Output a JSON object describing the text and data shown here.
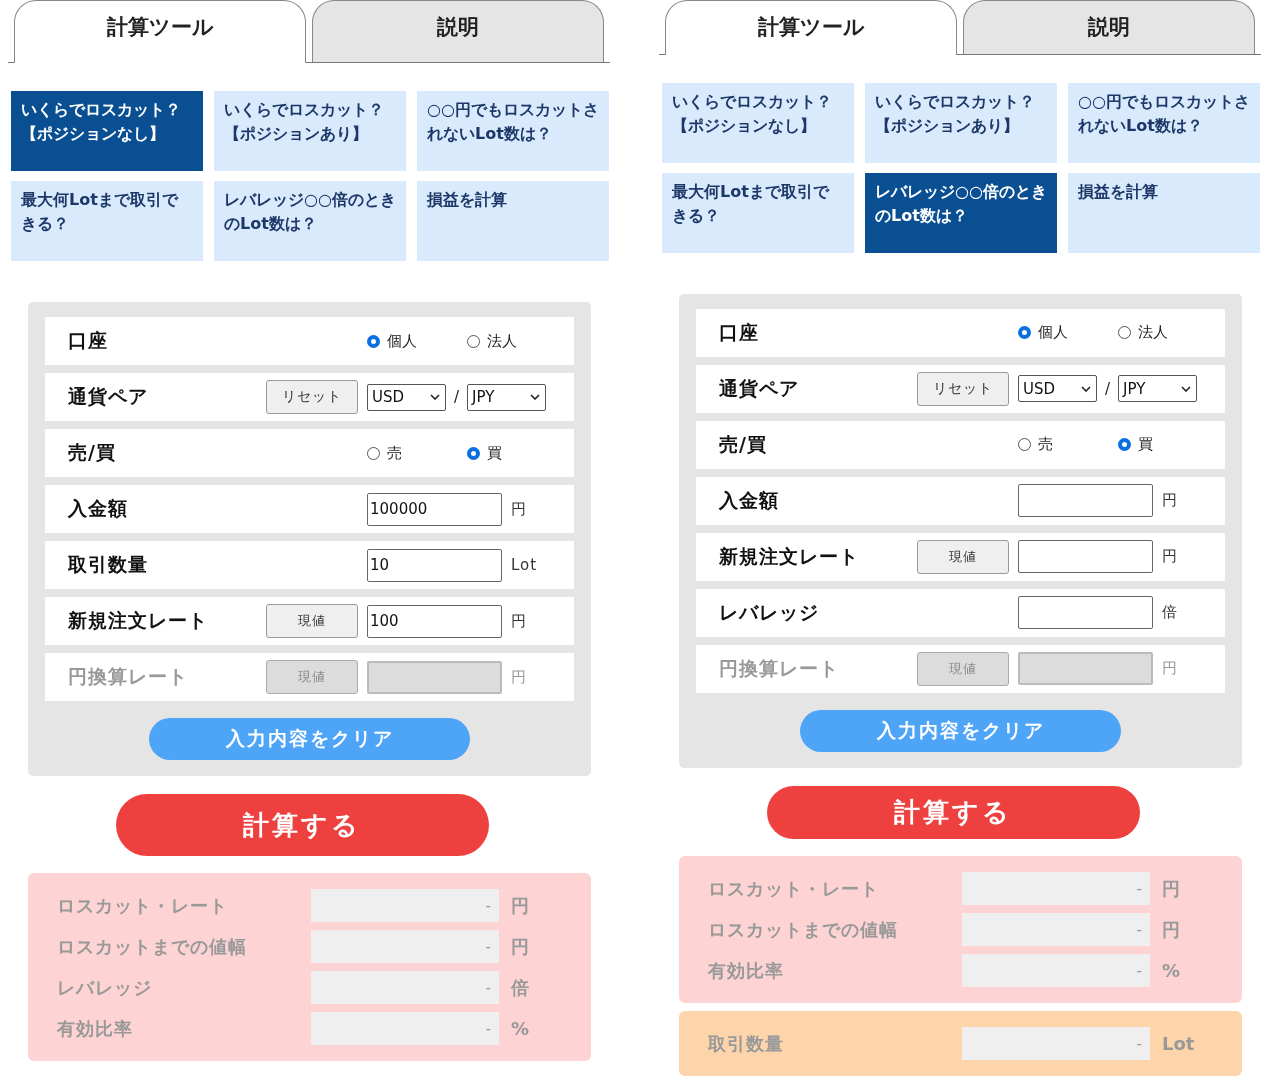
{
  "panels": [
    {
      "tabs": [
        {
          "label": "計算ツール",
          "selected": true
        },
        {
          "label": "説明",
          "selected": false
        }
      ],
      "tools": [
        {
          "label": "いくらでロスカット？【ポジションなし】",
          "selected": true
        },
        {
          "label": "いくらでロスカット？【ポジションあり】",
          "selected": false
        },
        {
          "label": "○○円でもロスカットされないLot数は？",
          "selected": false
        },
        {
          "label": "最大何Lotまで取引できる？",
          "selected": false
        },
        {
          "label": "レバレッジ○○倍のときのLot数は？",
          "selected": false
        },
        {
          "label": "損益を計算",
          "selected": false
        }
      ],
      "form": {
        "rows": [
          {
            "kind": "radio",
            "label": "口座",
            "options": [
              {
                "label": "個人",
                "selected": true
              },
              {
                "label": "法人",
                "selected": false
              }
            ]
          },
          {
            "kind": "currency",
            "label": "通貨ペア",
            "button": "リセット",
            "base": "USD",
            "separator": "/",
            "quote": "JPY"
          },
          {
            "kind": "radio",
            "label": "売/買",
            "options": [
              {
                "label": "売",
                "selected": false
              },
              {
                "label": "買",
                "selected": true
              }
            ]
          },
          {
            "kind": "input",
            "label": "入金額",
            "value": "100000",
            "unit": "円",
            "disabled": false
          },
          {
            "kind": "input",
            "label": "取引数量",
            "value": "10",
            "unit": "Lot",
            "disabled": false
          },
          {
            "kind": "input",
            "label": "新規注文レート",
            "button": "現値",
            "value": "100",
            "unit": "円",
            "disabled": false
          },
          {
            "kind": "input",
            "label": "円換算レート",
            "button": "現値",
            "unit": "円",
            "disabled": true
          }
        ],
        "clear_button": "入力内容をクリア"
      },
      "calculate_button": "計算する",
      "results": [
        {
          "color": "#fdd3d4",
          "rows": [
            {
              "label": "ロスカット・レート",
              "value": "-",
              "unit": "円"
            },
            {
              "label": "ロスカットまでの値幅",
              "value": "-",
              "unit": "円"
            },
            {
              "label": "レバレッジ",
              "value": "-",
              "unit": "倍"
            },
            {
              "label": "有効比率",
              "value": "-",
              "unit": "%"
            }
          ]
        }
      ]
    },
    {
      "tabs": [
        {
          "label": "計算ツール",
          "selected": true
        },
        {
          "label": "説明",
          "selected": false
        }
      ],
      "tools": [
        {
          "label": "いくらでロスカット？【ポジションなし】",
          "selected": false
        },
        {
          "label": "いくらでロスカット？【ポジションあり】",
          "selected": false
        },
        {
          "label": "○○円でもロスカットされないLot数は？",
          "selected": false
        },
        {
          "label": "最大何Lotまで取引できる？",
          "selected": false
        },
        {
          "label": "レバレッジ○○倍のときのLot数は？",
          "selected": true
        },
        {
          "label": "損益を計算",
          "selected": false
        }
      ],
      "form": {
        "rows": [
          {
            "kind": "radio",
            "label": "口座",
            "options": [
              {
                "label": "個人",
                "selected": true
              },
              {
                "label": "法人",
                "selected": false
              }
            ]
          },
          {
            "kind": "currency",
            "label": "通貨ペア",
            "button": "リセット",
            "base": "USD",
            "separator": "/",
            "quote": "JPY"
          },
          {
            "kind": "radio",
            "label": "売/買",
            "options": [
              {
                "label": "売",
                "selected": false
              },
              {
                "label": "買",
                "selected": true
              }
            ]
          },
          {
            "kind": "input",
            "label": "入金額",
            "unit": "円",
            "disabled": false
          },
          {
            "kind": "input",
            "label": "新規注文レート",
            "button": "現値",
            "unit": "円",
            "disabled": false
          },
          {
            "kind": "input",
            "label": "レバレッジ",
            "unit": "倍",
            "disabled": false
          },
          {
            "kind": "input",
            "label": "円換算レート",
            "button": "現値",
            "unit": "円",
            "disabled": true
          }
        ],
        "clear_button": "入力内容をクリア"
      },
      "calculate_button": "計算する",
      "results": [
        {
          "color": "#fdd3d4",
          "rows": [
            {
              "label": "ロスカット・レート",
              "value": "-",
              "unit": "円"
            },
            {
              "label": "ロスカットまでの値幅",
              "value": "-",
              "unit": "円"
            },
            {
              "label": "有効比率",
              "value": "-",
              "unit": "%"
            }
          ]
        },
        {
          "color": "#fed5aa",
          "rows": [
            {
              "label": "取引数量",
              "value": "-",
              "unit": "Lot"
            }
          ]
        }
      ]
    }
  ]
}
